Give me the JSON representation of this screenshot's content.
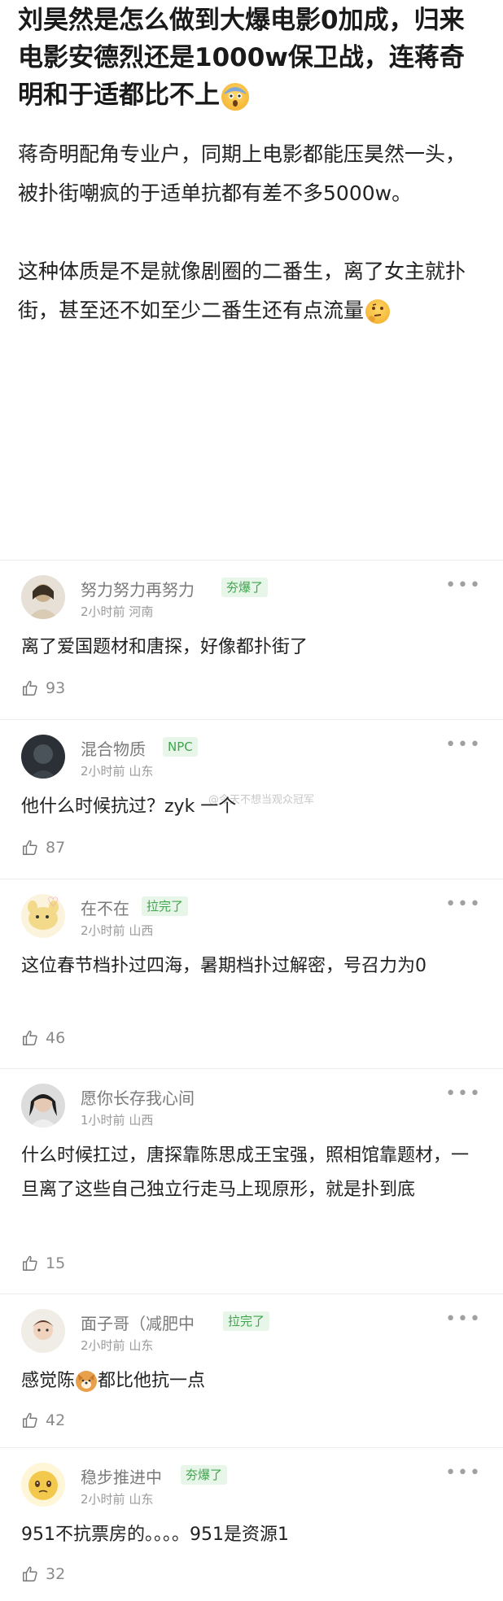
{
  "post": {
    "title": "刘昊然是怎么做到大爆电影0加成，归来电影安德烈还是1000w保卫战，连蒋奇明和于适都比不上",
    "title_emoji": "face-screaming-in-fear-icon",
    "paragraph1": "蒋奇明配角专业户，同期上电影都能压昊然一头，被扑街嘲疯的于适单抗都有差不多5000w。",
    "paragraph2": "这种体质是不是就像剧圈的二番生，离了女主就扑街，甚至还不如至少二番生还有点流量",
    "paragraph2_emoji": "thinking-face-icon"
  },
  "watermark": "@今天不想当观众冠军",
  "comments": [
    {
      "username": "努力努力再努力",
      "badge": "夯爆了",
      "time": "2小时前",
      "location": "河南",
      "text": "离了爱国题材和唐探，好像都扑街了",
      "likes": "93",
      "avatar_color": "#c9b08c"
    },
    {
      "username": "混合物质",
      "badge": "NPC",
      "time": "2小时前",
      "location": "山东",
      "text": "他什么时候抗过？zyk 一个",
      "likes": "87",
      "avatar_color": "#2a3036"
    },
    {
      "username": "在不在",
      "badge": "拉完了",
      "time": "2小时前",
      "location": "山西",
      "text": "这位春节档扑过四海，暑期档扑过解密，号召力为0",
      "likes": "46",
      "avatar_color": "#f3d98a"
    },
    {
      "username": "愿你长存我心间",
      "badge": "",
      "time": "1小时前",
      "location": "山西",
      "text": "什么时候扛过，唐探靠陈思成王宝强，照相馆靠题材，一旦离了这些自己独立行走马上现原形，就是扑到底",
      "likes": "15",
      "avatar_color": "#3b3b3b"
    },
    {
      "username": "面子哥（减肥中",
      "badge": "拉完了",
      "time": "2小时前",
      "location": "山东",
      "text_before": "感觉陈",
      "text_emoji": "dog-face-icon",
      "text_after": "都比他抗一点",
      "likes": "42",
      "avatar_color": "#d7c2b2"
    },
    {
      "username": "稳步推进中",
      "badge": "夯爆了",
      "time": "2小时前",
      "location": "山东",
      "text": "951不抗票房的。。。。951是资源1",
      "likes": "32",
      "avatar_color": "#f2c94c"
    }
  ],
  "more_label": "•••"
}
